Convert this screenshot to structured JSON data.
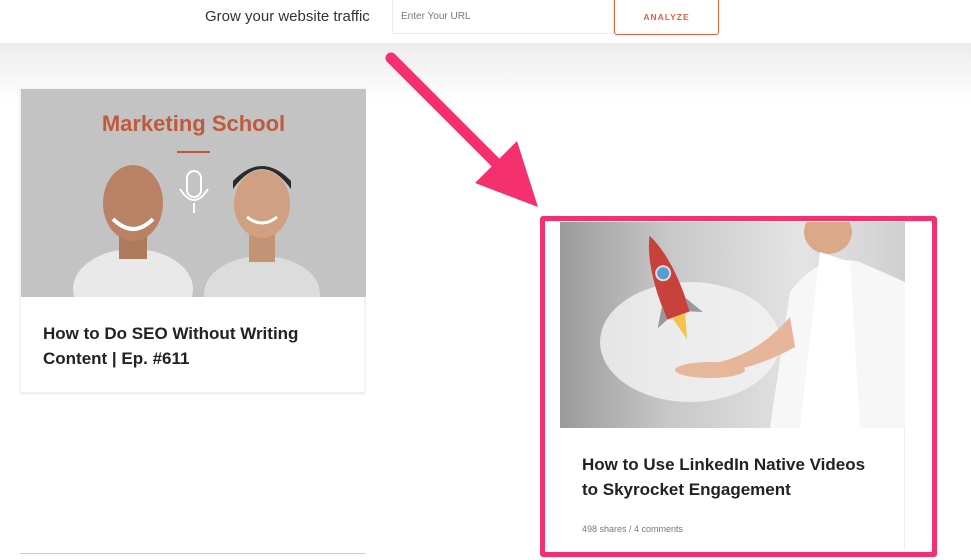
{
  "header": {
    "tagline": "Grow your website traffic",
    "url_placeholder": "Enter Your URL",
    "analyze_label": "ANALYZE"
  },
  "posts": [
    {
      "image_text": "Marketing School",
      "title_line1": "How to Do SEO Without Writing",
      "title_line2": "Content | Ep. #611"
    },
    {
      "title_line1": "How to Use LinkedIn Native Videos",
      "title_line2": "to Skyrocket Engagement",
      "meta": "498 shares / 4 comments"
    }
  ],
  "colors": {
    "accent": "#e2603a",
    "highlight": "#f5306f",
    "marketing_school": "#c05a3c"
  }
}
